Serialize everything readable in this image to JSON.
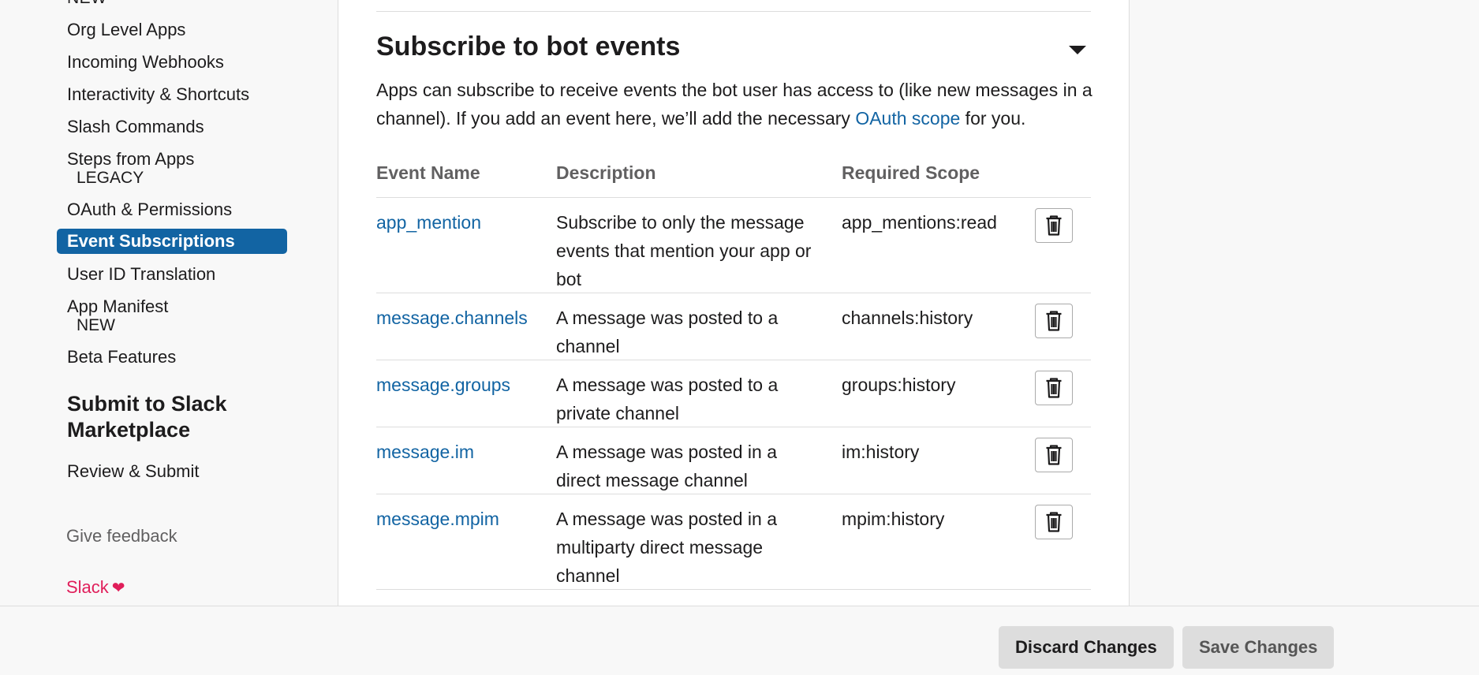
{
  "sidebar": {
    "clipped_label": "NEW",
    "items": [
      {
        "label": "Org Level Apps"
      },
      {
        "label": "Incoming Webhooks"
      },
      {
        "label": "Interactivity & Shortcuts"
      },
      {
        "label": "Slash Commands"
      },
      {
        "label": "Steps from Apps",
        "sub": "LEGACY"
      },
      {
        "label": "OAuth & Permissions"
      },
      {
        "label": "Event Subscriptions",
        "active": true
      },
      {
        "label": "User ID Translation"
      },
      {
        "label": "App Manifest",
        "sub": "NEW"
      },
      {
        "label": "Beta Features"
      }
    ],
    "section_heading": "Submit to Slack Marketplace",
    "review_label": "Review & Submit",
    "feedback_label": "Give feedback",
    "slack_label": "Slack",
    "heart_glyph": "❤"
  },
  "main": {
    "title": "Subscribe to bot events",
    "intro_before": "Apps can subscribe to receive events the bot user has access to (like new messages in a channel). If you add an event here, we’ll add the necessary ",
    "intro_link": "OAuth scope",
    "intro_after": " for you.",
    "columns": {
      "name": "Event Name",
      "description": "Description",
      "scope": "Required Scope"
    },
    "events": [
      {
        "name": "app_mention",
        "description": "Subscribe to only the message events that mention your app or bot",
        "scope": "app_mentions:read"
      },
      {
        "name": "message.channels",
        "description": "A message was posted to a channel",
        "scope": "channels:history"
      },
      {
        "name": "message.groups",
        "description": "A message was posted to a private channel",
        "scope": "groups:history"
      },
      {
        "name": "message.im",
        "description": "A message was posted in a direct message channel",
        "scope": "im:history"
      },
      {
        "name": "message.mpim",
        "description": "A message was posted in a multiparty direct message channel",
        "scope": "mpim:history"
      }
    ]
  },
  "footer": {
    "discard_label": "Discard Changes",
    "save_label": "Save Changes"
  },
  "colors": {
    "accent": "#1264a3",
    "brand_pink": "#e01e5a"
  },
  "icons": {
    "collapse": "caret-down-icon",
    "delete": "trash-icon"
  }
}
